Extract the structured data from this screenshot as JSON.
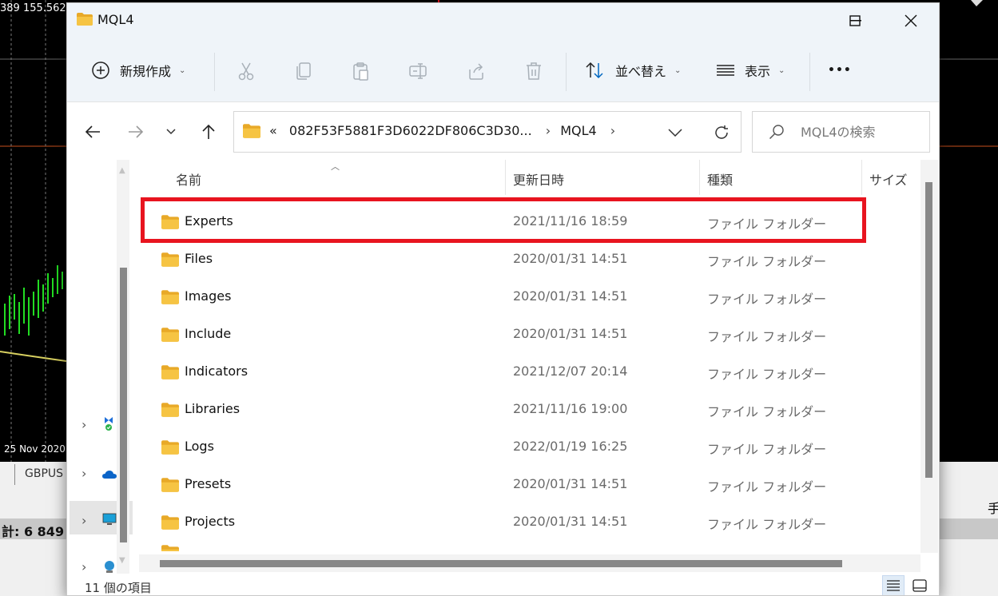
{
  "background": {
    "price_label": "389 155.562",
    "date_label": "25 Nov 2020",
    "tab_label": "GBPUS",
    "total_label": "計: 6 849",
    "right_label": "手"
  },
  "window": {
    "title": "MQL4",
    "controls": {
      "minimize": "—",
      "maximize": "☐",
      "close": "✕"
    }
  },
  "toolbar": {
    "new_label": "新規作成",
    "sort_label": "並べ替え",
    "view_label": "表示",
    "more_label": "•••"
  },
  "address": {
    "overflow": "«",
    "parent": "082F53F5881F3D6022DF806C3D30...",
    "current": "MQL4",
    "sep": "›"
  },
  "search": {
    "placeholder": "MQL4の検索"
  },
  "columns": {
    "name": "名前",
    "modified": "更新日時",
    "type": "種類",
    "size": "サイズ"
  },
  "files": [
    {
      "name": "Experts",
      "modified": "2021/11/16 18:59",
      "type": "ファイル フォルダー"
    },
    {
      "name": "Files",
      "modified": "2020/01/31 14:51",
      "type": "ファイル フォルダー"
    },
    {
      "name": "Images",
      "modified": "2020/01/31 14:51",
      "type": "ファイル フォルダー"
    },
    {
      "name": "Include",
      "modified": "2020/01/31 14:51",
      "type": "ファイル フォルダー"
    },
    {
      "name": "Indicators",
      "modified": "2021/12/07 20:14",
      "type": "ファイル フォルダー"
    },
    {
      "name": "Libraries",
      "modified": "2021/11/16 19:00",
      "type": "ファイル フォルダー"
    },
    {
      "name": "Logs",
      "modified": "2022/01/19 16:25",
      "type": "ファイル フォルダー"
    },
    {
      "name": "Presets",
      "modified": "2020/01/31 14:51",
      "type": "ファイル フォルダー"
    },
    {
      "name": "Projects",
      "modified": "2020/01/31 14:51",
      "type": "ファイル フォルダー"
    }
  ],
  "status": {
    "item_count": "11 個の項目"
  },
  "colors": {
    "folder": "#f6c443",
    "folder_dark": "#e8a928",
    "highlight": "#e8141f",
    "accent": "#0067c0"
  }
}
